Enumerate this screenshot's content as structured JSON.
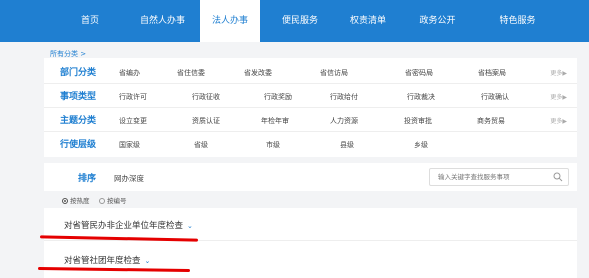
{
  "nav": [
    "首页",
    "自然人办事",
    "法人办事",
    "便民服务",
    "权责清单",
    "政务公开",
    "特色服务"
  ],
  "breadcrumb": "所有分类 >",
  "categories": [
    {
      "label": "部门分类",
      "items": [
        "省编办",
        "省住信委",
        "省发改委",
        "省信访局",
        "省密码局",
        "省档案局"
      ],
      "more": "更多▶"
    },
    {
      "label": "事项类型",
      "items": [
        "行政许可",
        "行政征收",
        "行政奖励",
        "行政给付",
        "行政裁决",
        "行政确认"
      ],
      "more": "更多▶"
    },
    {
      "label": "主题分类",
      "items": [
        "设立变更",
        "资质认证",
        "年检年审",
        "人力资源",
        "投资审批",
        "商务贸易"
      ],
      "more": "更多▶"
    },
    {
      "label": "行使层级",
      "items": [
        "国家级",
        "省级",
        "市级",
        "县级",
        "乡级"
      ],
      "more": ""
    }
  ],
  "sort": {
    "label": "排序",
    "value": "网办深度",
    "search_placeholder": "输入关键字查找服务事项"
  },
  "sort_options": [
    "按热度",
    "按编号"
  ],
  "results": [
    "对省管民办非企业单位年度检查",
    "对省管社团年度检查"
  ],
  "colors": {
    "accent": "#1f7fd1",
    "annotation": "#e50000"
  }
}
